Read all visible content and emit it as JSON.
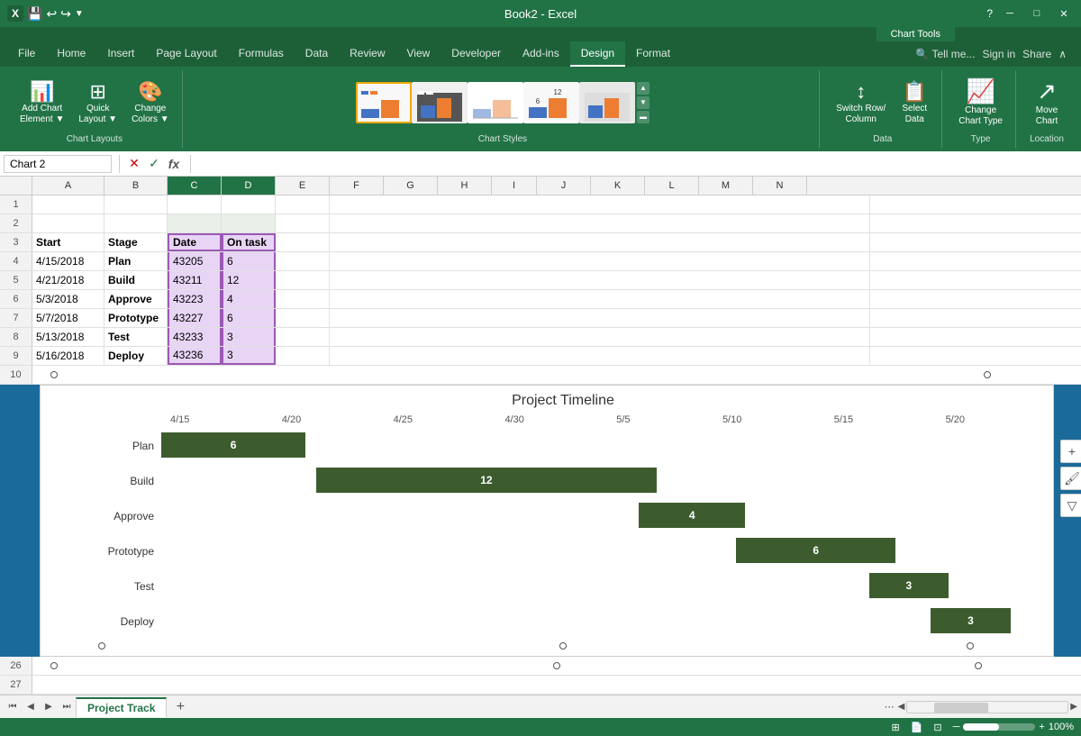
{
  "titleBar": {
    "title": "Book2 - Excel",
    "saveLabel": "💾",
    "undoLabel": "↩",
    "redoLabel": "↪",
    "minimizeLabel": "─",
    "maximizeLabel": "□",
    "closeLabel": "✕"
  },
  "chartToolsLabel": "Chart Tools",
  "ribbonTabs": [
    {
      "id": "file",
      "label": "File"
    },
    {
      "id": "home",
      "label": "Home"
    },
    {
      "id": "insert",
      "label": "Insert"
    },
    {
      "id": "pagelayout",
      "label": "Page Layout"
    },
    {
      "id": "formulas",
      "label": "Formulas"
    },
    {
      "id": "data",
      "label": "Data"
    },
    {
      "id": "review",
      "label": "Review"
    },
    {
      "id": "view",
      "label": "View"
    },
    {
      "id": "developer",
      "label": "Developer"
    },
    {
      "id": "addins",
      "label": "Add-ins"
    },
    {
      "id": "design",
      "label": "Design",
      "active": true,
      "chartTool": true
    },
    {
      "id": "format",
      "label": "Format",
      "chartTool": true
    }
  ],
  "groups": {
    "chartLayouts": {
      "label": "Chart Layouts",
      "addChartElement": "Add Chart\nElement",
      "quickLayout": "Quick\nLayout",
      "changeColors": "Change\nColors"
    },
    "chartStyles": {
      "label": "Chart Styles"
    },
    "data": {
      "label": "Data",
      "switchRowCol": "Switch Row/\nColumn",
      "selectData": "Select\nData"
    },
    "type": {
      "label": "Type",
      "changeChartType": "Change\nChart Type"
    },
    "location": {
      "label": "Location",
      "moveChart": "Move\nChart"
    }
  },
  "formulaBar": {
    "nameBox": "Chart 2",
    "cancelLabel": "✕",
    "confirmLabel": "✓",
    "functionLabel": "fx"
  },
  "columns": [
    "A",
    "B",
    "C",
    "D",
    "E",
    "F",
    "G",
    "H",
    "I",
    "J",
    "K",
    "L",
    "M",
    "N"
  ],
  "rows": [
    {
      "num": 1,
      "cells": []
    },
    {
      "num": 2,
      "cells": []
    },
    {
      "num": 3,
      "cells": [
        {
          "col": "A",
          "val": "Start",
          "bold": true
        },
        {
          "col": "B",
          "val": "Stage",
          "bold": true
        },
        {
          "col": "C",
          "val": "Date",
          "bold": true,
          "highlight": true
        },
        {
          "col": "D",
          "val": "On task",
          "bold": true,
          "highlight": true
        }
      ]
    },
    {
      "num": 4,
      "cells": [
        {
          "col": "A",
          "val": "4/15/2018"
        },
        {
          "col": "B",
          "val": "Plan",
          "bold": true
        },
        {
          "col": "C",
          "val": "43205",
          "highlight": true
        },
        {
          "col": "D",
          "val": "6",
          "highlight": true
        }
      ]
    },
    {
      "num": 5,
      "cells": [
        {
          "col": "A",
          "val": "4/21/2018"
        },
        {
          "col": "B",
          "val": "Build",
          "bold": true
        },
        {
          "col": "C",
          "val": "43211",
          "highlight": true
        },
        {
          "col": "D",
          "val": "12",
          "highlight": true
        }
      ]
    },
    {
      "num": 6,
      "cells": [
        {
          "col": "A",
          "val": "5/3/2018"
        },
        {
          "col": "B",
          "val": "Approve",
          "bold": true
        },
        {
          "col": "C",
          "val": "43223",
          "highlight": true
        },
        {
          "col": "D",
          "val": "4",
          "highlight": true
        }
      ]
    },
    {
      "num": 7,
      "cells": [
        {
          "col": "A",
          "val": "5/7/2018"
        },
        {
          "col": "B",
          "val": "Prototype",
          "bold": true
        },
        {
          "col": "C",
          "val": "43227",
          "highlight": true
        },
        {
          "col": "D",
          "val": "6",
          "highlight": true
        }
      ]
    },
    {
      "num": 8,
      "cells": [
        {
          "col": "A",
          "val": "5/13/2018"
        },
        {
          "col": "B",
          "val": "Test",
          "bold": true
        },
        {
          "col": "C",
          "val": "43233",
          "highlight": true
        },
        {
          "col": "D",
          "val": "3",
          "highlight": true
        }
      ]
    },
    {
      "num": 9,
      "cells": [
        {
          "col": "A",
          "val": "5/16/2018"
        },
        {
          "col": "B",
          "val": "Deploy",
          "bold": true
        },
        {
          "col": "C",
          "val": "43236",
          "highlight": true
        },
        {
          "col": "D",
          "val": "3",
          "highlight": true
        }
      ]
    }
  ],
  "chart": {
    "title": "Project Timeline",
    "xAxisLabels": [
      "4/15",
      "4/20",
      "4/25",
      "4/30",
      "5/5",
      "5/10",
      "5/15",
      "5/20"
    ],
    "tasks": [
      {
        "label": "Plan",
        "start": 0,
        "width": 17,
        "value": "6"
      },
      {
        "label": "Build",
        "start": 17.6,
        "width": 38.5,
        "value": "12"
      },
      {
        "label": "Approve",
        "start": 53.8,
        "width": 12.8,
        "value": "4"
      },
      {
        "label": "Prototype",
        "start": 65,
        "width": 19.2,
        "value": "6"
      },
      {
        "label": "Test",
        "start": 83.3,
        "width": 9.6,
        "value": "3"
      },
      {
        "label": "Deploy",
        "start": 91.5,
        "width": 9.6,
        "value": "3"
      }
    ]
  },
  "sheetTabs": [
    {
      "label": "Project Track",
      "active": true
    }
  ],
  "addSheetLabel": "+",
  "statusBar": {
    "left": "",
    "right": ""
  },
  "tellMeLabel": "Tell me...",
  "signInLabel": "Sign in",
  "shareLabel": "Share"
}
